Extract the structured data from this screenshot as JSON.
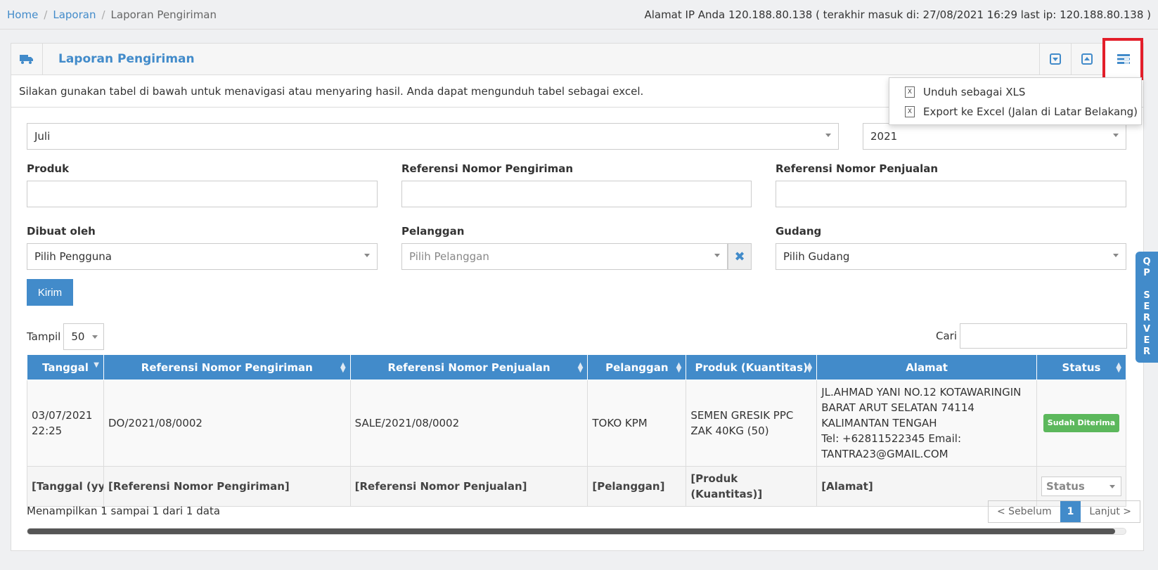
{
  "breadcrumb": {
    "home": "Home",
    "laporan": "Laporan",
    "current": "Laporan Pengiriman"
  },
  "ip_info": "Alamat IP Anda 120.188.80.138 ( terakhir masuk di: 27/08/2021 16:29 last ip: 120.188.80.138 )",
  "box": {
    "title": "Laporan Pengiriman",
    "intro": "Silakan gunakan tabel di bawah untuk menavigasi atau menyaring hasil. Anda dapat mengunduh tabel sebagai excel."
  },
  "dropdown": {
    "items": [
      "Unduh sebagai XLS",
      "Export ke Excel (Jalan di Latar Belakang)"
    ]
  },
  "filters": {
    "month": "Juli",
    "year": "2021",
    "produk_label": "Produk",
    "ref_kirim_label": "Referensi Nomor Pengiriman",
    "ref_jual_label": "Referensi Nomor Penjualan",
    "dibuat_label": "Dibuat oleh",
    "dibuat_value": "Pilih Pengguna",
    "pelanggan_label": "Pelanggan",
    "pelanggan_placeholder": "Pilih Pelanggan",
    "gudang_label": "Gudang",
    "gudang_value": "Pilih Gudang",
    "submit": "Kirim"
  },
  "table_controls": {
    "tampil_label": "Tampil",
    "tampil_value": "50",
    "cari_label": "Cari"
  },
  "table": {
    "headers": [
      "Tanggal",
      "Referensi Nomor Pengiriman",
      "Referensi Nomor Penjualan",
      "Pelanggan",
      "Produk (Kuantitas)",
      "Alamat",
      "Status"
    ],
    "row": {
      "tanggal": "03/07/2021 22:25",
      "ref_kirim": "DO/2021/08/0002",
      "ref_jual": "SALE/2021/08/0002",
      "pelanggan": "TOKO KPM",
      "produk": "SEMEN GRESIK PPC ZAK 40KG (50)",
      "alamat": "JL.AHMAD YANI NO.12 KOTAWARINGIN BARAT ARUT SELATAN 74114 KALIMANTAN TENGAH",
      "alamat_contact": "Tel: +62811522345 Email: TANTRA23@GMAIL.COM",
      "status": "Sudah Diterima"
    },
    "filter_row": [
      "[Tanggal (yyy",
      "[Referensi Nomor Pengiriman]",
      "[Referensi Nomor Penjualan]",
      "[Pelanggan]",
      "[Produk (Kuantitas)]",
      "[Alamat]",
      "Status"
    ]
  },
  "footer": {
    "info": "Menampilkan 1 sampai 1 dari 1 data",
    "prev": "< Sebelum",
    "page": "1",
    "next": "Lanjut >"
  },
  "side_tab": "QP SERVER",
  "colors": {
    "primary": "#428bca",
    "highlight": "#e31e2a",
    "success": "#5cb85c"
  }
}
